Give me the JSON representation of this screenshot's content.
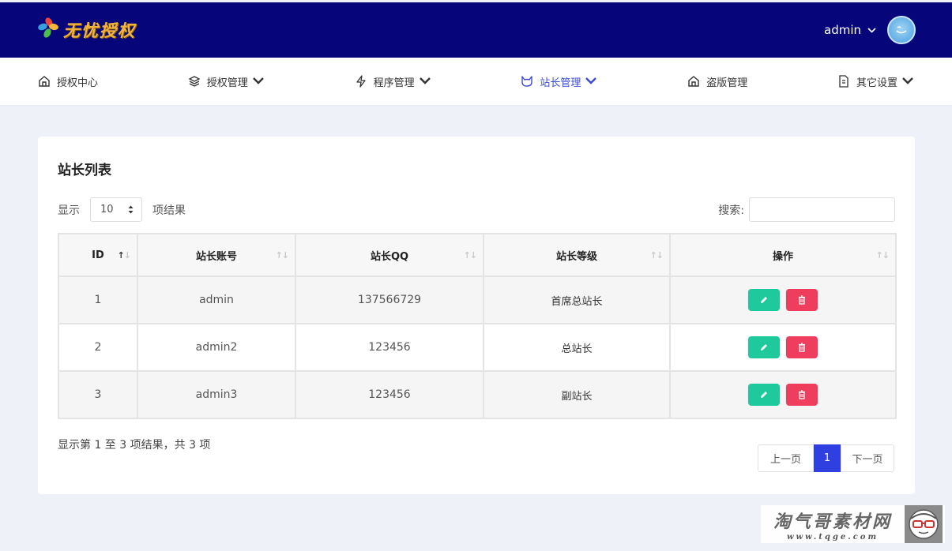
{
  "header": {
    "logo_text": "无忧授权",
    "user_name": "admin",
    "user_chevron": "⌄"
  },
  "nav": {
    "items": [
      {
        "label": "授权中心",
        "icon": "home-icon",
        "has_dropdown": false
      },
      {
        "label": "授权管理",
        "icon": "layers-icon",
        "has_dropdown": true
      },
      {
        "label": "程序管理",
        "icon": "lightning-icon",
        "has_dropdown": true
      },
      {
        "label": "站长管理",
        "icon": "cat-icon",
        "has_dropdown": true,
        "active": true
      },
      {
        "label": "盗版管理",
        "icon": "home-icon",
        "has_dropdown": false
      },
      {
        "label": "其它设置",
        "icon": "document-icon",
        "has_dropdown": true
      }
    ],
    "chevron": "⌄"
  },
  "panel": {
    "title": "站长列表",
    "length_prefix": "显示",
    "length_value": "10",
    "length_suffix": "项结果",
    "search_label": "搜索:",
    "search_value": ""
  },
  "table": {
    "columns": [
      "ID",
      "站长账号",
      "站长QQ",
      "站长等级",
      "操作"
    ],
    "rows": [
      {
        "id": "1",
        "account": "admin",
        "qq": "137566729",
        "level": "首席总站长"
      },
      {
        "id": "2",
        "account": "admin2",
        "qq": "123456",
        "level": "总站长"
      },
      {
        "id": "3",
        "account": "admin3",
        "qq": "123456",
        "level": "副站长"
      }
    ]
  },
  "footer": {
    "info": "显示第 1 至 3 项结果，共 3 项",
    "prev": "上一页",
    "current_page": "1",
    "next": "下一页"
  },
  "watermark": {
    "main": "淘气哥素材网",
    "url": "www.tqge.com"
  },
  "colors": {
    "topbar": "#06067a",
    "active_nav": "#3a4bd6",
    "edit_button": "#1ec99b",
    "delete_button": "#ee3d5d",
    "pager_current": "#3040e0"
  }
}
